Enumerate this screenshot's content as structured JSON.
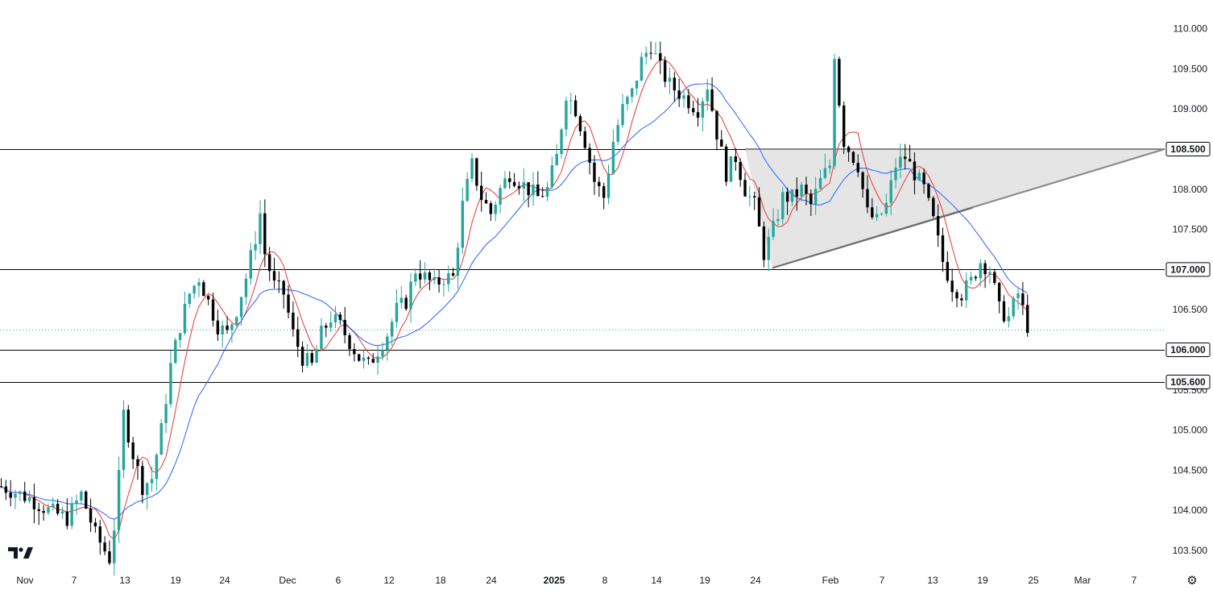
{
  "chart_data": {
    "type": "candlestick",
    "price_axis": {
      "ylim": [
        103.3,
        110.2
      ],
      "ticks": [
        "110.000",
        "109.500",
        "109.000",
        "108.500",
        "108.000",
        "107.500",
        "107.000",
        "106.500",
        "106.000",
        "105.500",
        "105.000",
        "104.500",
        "104.000",
        "103.500"
      ]
    },
    "time_axis": {
      "ticks": [
        "Nov",
        "7",
        "13",
        "19",
        "24",
        "Dec",
        "6",
        "12",
        "18",
        "24",
        "2025",
        "8",
        "14",
        "19",
        "24",
        "Feb",
        "7",
        "13",
        "19",
        "25",
        "Mar",
        "7"
      ]
    },
    "horizontal_levels": [
      {
        "value": 108.5,
        "label": "108.500"
      },
      {
        "value": 107.0,
        "label": "107.000"
      },
      {
        "value": 106.0,
        "label": "106.000"
      },
      {
        "value": 105.6,
        "label": "105.600"
      }
    ],
    "current_price": 106.25,
    "triangle_pattern": {
      "upper_level": 108.5,
      "lower_start": 107.02,
      "lower_end": 108.5,
      "lower_mid": 107.77
    },
    "price_path": [
      [
        0,
        104.3
      ],
      [
        6,
        104.15
      ],
      [
        10,
        104.0
      ],
      [
        14,
        103.9
      ],
      [
        17,
        104.2
      ],
      [
        20,
        103.7
      ],
      [
        23,
        103.4
      ],
      [
        24.5,
        104.0
      ],
      [
        26,
        105.2
      ],
      [
        28,
        104.7
      ],
      [
        30,
        104.3
      ],
      [
        32,
        104.4
      ],
      [
        34,
        105.0
      ],
      [
        36,
        105.8
      ],
      [
        38,
        106.3
      ],
      [
        40,
        106.7
      ],
      [
        42,
        106.9
      ],
      [
        44,
        106.6
      ],
      [
        46,
        106.3
      ],
      [
        48,
        106.2
      ],
      [
        50,
        106.5
      ],
      [
        52,
        106.9
      ],
      [
        54,
        107.4
      ],
      [
        55,
        107.7
      ],
      [
        56,
        107.2
      ],
      [
        58,
        106.8
      ],
      [
        60,
        106.7
      ],
      [
        62,
        106.2
      ],
      [
        64,
        105.9
      ],
      [
        66,
        105.8
      ],
      [
        68,
        106.2
      ],
      [
        70,
        106.4
      ],
      [
        72,
        106.3
      ],
      [
        74,
        106.1
      ],
      [
        76,
        105.9
      ],
      [
        78,
        105.8
      ],
      [
        80,
        106.0
      ],
      [
        82,
        106.2
      ],
      [
        84,
        106.5
      ],
      [
        86,
        106.6
      ],
      [
        88,
        107.0
      ],
      [
        90,
        106.9
      ],
      [
        92,
        106.8
      ],
      [
        94,
        106.9
      ],
      [
        96,
        106.9
      ],
      [
        98,
        107.8
      ],
      [
        100,
        108.3
      ],
      [
        102,
        107.9
      ],
      [
        104,
        107.7
      ],
      [
        106,
        108.0
      ],
      [
        108,
        108.2
      ],
      [
        110,
        108.1
      ],
      [
        112,
        108.0
      ],
      [
        114,
        107.9
      ],
      [
        116,
        108.0
      ],
      [
        118,
        108.4
      ],
      [
        120,
        109.2
      ],
      [
        122,
        109.0
      ],
      [
        124,
        108.6
      ],
      [
        126,
        108.1
      ],
      [
        128,
        107.9
      ],
      [
        130,
        108.6
      ],
      [
        132,
        109.0
      ],
      [
        134,
        109.2
      ],
      [
        136,
        109.6
      ],
      [
        138,
        109.8
      ],
      [
        140,
        109.5
      ],
      [
        142,
        109.3
      ],
      [
        144,
        109.2
      ],
      [
        146,
        109.1
      ],
      [
        148,
        109.0
      ],
      [
        150,
        109.3
      ],
      [
        152,
        108.7
      ],
      [
        154,
        108.2
      ],
      [
        156,
        108.4
      ],
      [
        158,
        108.0
      ],
      [
        160,
        107.8
      ],
      [
        162,
        107.2
      ],
      [
        164,
        107.5
      ],
      [
        166,
        107.9
      ],
      [
        168,
        107.9
      ],
      [
        170,
        108.0
      ],
      [
        172,
        107.8
      ],
      [
        174,
        108.1
      ],
      [
        176,
        108.3
      ],
      [
        177,
        109.7
      ],
      [
        178,
        109.1
      ],
      [
        179,
        108.6
      ],
      [
        180,
        108.5
      ],
      [
        182,
        108.3
      ],
      [
        184,
        107.7
      ],
      [
        186,
        107.6
      ],
      [
        188,
        107.8
      ],
      [
        190,
        108.3
      ],
      [
        192,
        108.4
      ],
      [
        194,
        108.2
      ],
      [
        196,
        108.0
      ],
      [
        198,
        107.6
      ],
      [
        200,
        107.1
      ],
      [
        202,
        106.8
      ],
      [
        204,
        106.7
      ],
      [
        206,
        106.85
      ],
      [
        208,
        107.1
      ],
      [
        210,
        107.0
      ],
      [
        212,
        106.5
      ],
      [
        214,
        106.4
      ],
      [
        216,
        106.7
      ],
      [
        218,
        106.3
      ]
    ],
    "volatility_seed": 7,
    "wick_max": 0.18,
    "ma_short": {
      "color": "#e53935",
      "period": 6
    },
    "ma_long": {
      "color": "#2962ff",
      "period": 17
    },
    "colors": {
      "up": "#26a69a",
      "down": "#000000",
      "level": "#000000",
      "triangle_fill": "#e5e5e5",
      "triangle_edge": "#868686",
      "current_line": "#26a69a",
      "axis_text": "#131722"
    }
  },
  "icons": {
    "logo": "tradingview-logo-icon",
    "settings": "settings-gear-icon"
  }
}
